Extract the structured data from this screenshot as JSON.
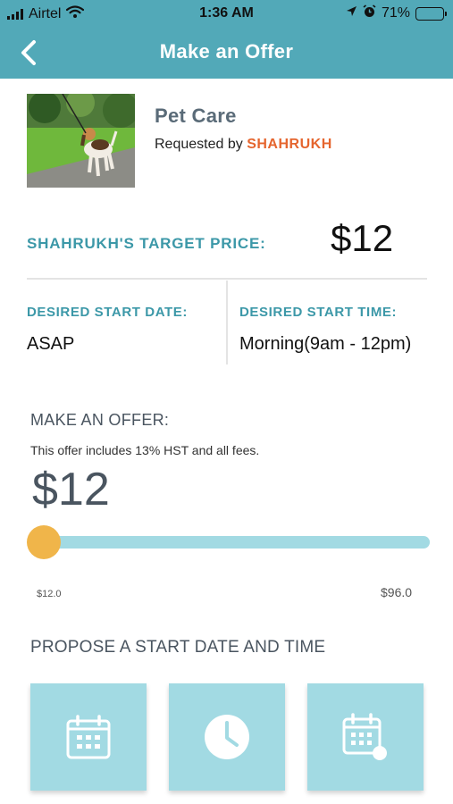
{
  "status_bar": {
    "carrier": "Airtel",
    "time": "1:36 AM",
    "battery_percent": "71%",
    "battery_level": 0.71,
    "icons": [
      "signal-icon",
      "wifi-icon",
      "location-icon",
      "alarm-icon",
      "battery-icon"
    ]
  },
  "nav": {
    "title": "Make an Offer",
    "back_icon": "chevron-left-icon",
    "bar_color": "#52a9b8"
  },
  "service": {
    "name": "Pet Care",
    "requested_by_prefix": "Requested by",
    "requester": "SHAHRUKH"
  },
  "target": {
    "label": "SHAHRUKH'S TARGET PRICE:",
    "price": "$12"
  },
  "schedule": {
    "start_date_label": "DESIRED START DATE:",
    "start_date_value": "ASAP",
    "start_time_label": "DESIRED START TIME:",
    "start_time_value": "Morning(9am - 12pm)"
  },
  "offer": {
    "title": "MAKE AN OFFER:",
    "note": "This offer includes 13% HST and all fees.",
    "amount": "$12",
    "slider_min_label": "$12.0",
    "slider_max_label": "$96.0",
    "slider_value": 12,
    "slider_min": 12,
    "slider_max": 96
  },
  "propose": {
    "title": "PROPOSE A START DATE AND TIME",
    "tiles": [
      "calendar-icon",
      "clock-icon",
      "calendar-time-icon"
    ]
  },
  "colors": {
    "accent": "#3c98a8",
    "requester": "#e5652e",
    "slider_track": "#a2dae3",
    "slider_thumb": "#f0b54a"
  }
}
